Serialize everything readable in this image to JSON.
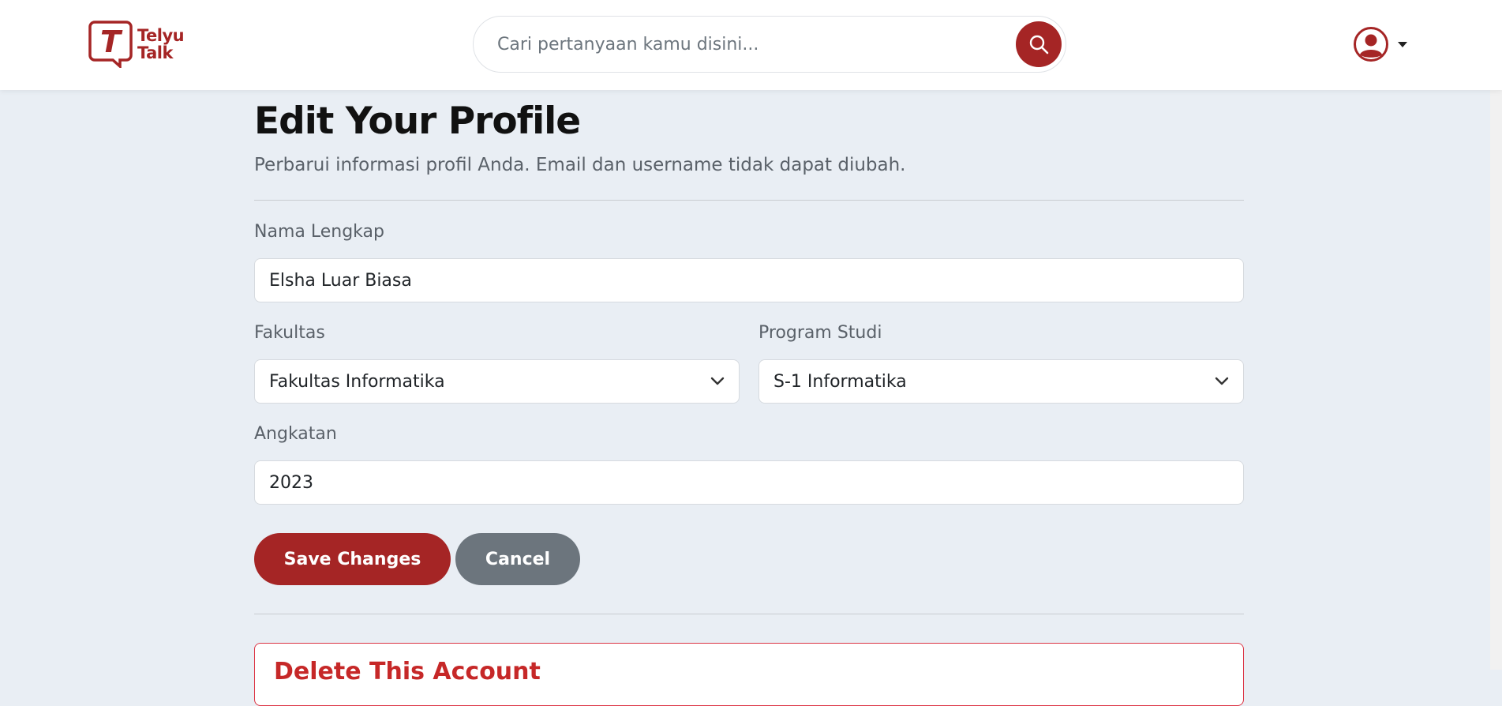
{
  "brand": {
    "name_line1": "Telyu",
    "name_line2": "Talk",
    "logo_letter": "T",
    "color": "#a52525"
  },
  "search": {
    "placeholder": "Cari pertanyaan kamu disini...",
    "value": ""
  },
  "page": {
    "title": "Edit Your Profile",
    "subtitle": "Perbarui informasi profil Anda. Email dan username tidak dapat diubah."
  },
  "form": {
    "full_name": {
      "label": "Nama Lengkap",
      "value": "Elsha Luar Biasa"
    },
    "faculty": {
      "label": "Fakultas",
      "value": "Fakultas Informatika"
    },
    "study_program": {
      "label": "Program Studi",
      "value": "S-1 Informatika"
    },
    "year": {
      "label": "Angkatan",
      "value": "2023"
    }
  },
  "actions": {
    "save_label": "Save Changes",
    "cancel_label": "Cancel"
  },
  "danger": {
    "title": "Delete This Account"
  },
  "colors": {
    "accent": "#a52525",
    "secondary": "#6c757d",
    "background": "#e9eef4",
    "danger_border": "#dc3545"
  }
}
